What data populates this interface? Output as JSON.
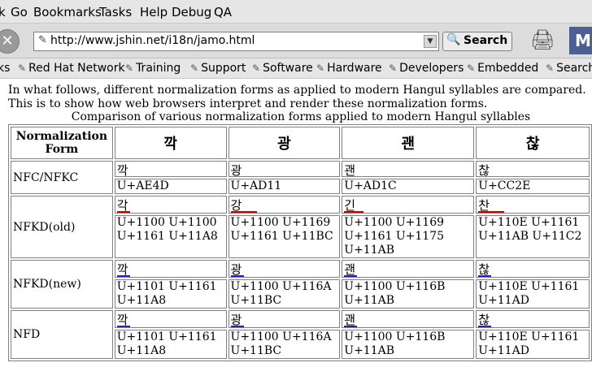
{
  "menubar": {
    "items": [
      "k",
      "Go",
      "Bookmarks",
      "Tasks",
      "Help",
      "Debug",
      "QA"
    ]
  },
  "navbar": {
    "url": "http://www.jshin.net/i18n/jamo.html",
    "search_label": "Search",
    "logo_text": "M"
  },
  "bookmarks": [
    "ks",
    "Red Hat Network",
    "Training",
    "Support",
    "Software",
    "Hardware",
    "Developers",
    "Embedded",
    "Search"
  ],
  "content": {
    "intro": "In what follows, different normalization forms as applied to modern Hangul syllables are compared. This is to show how web browsers interpret and render these normalization forms.",
    "caption": "Comparison of various normalization forms applied to modern Hangul syllables",
    "table": {
      "corner": "Normalization Form",
      "headers": [
        "깍",
        "광",
        "괜",
        "찮"
      ],
      "rows": [
        {
          "label": "NFC/NFKC",
          "cells": [
            {
              "glyph": "깍",
              "codes": "U+AE4D"
            },
            {
              "glyph": "광",
              "codes": "U+AD11"
            },
            {
              "glyph": "괜",
              "codes": "U+AD1C"
            },
            {
              "glyph": "찮",
              "codes": "U+CC2E"
            }
          ]
        },
        {
          "label": "NFKD(old)",
          "cells": [
            {
              "glyph": "각",
              "codes": "U+1100 U+1100 U+1161 U+11A8"
            },
            {
              "glyph": "강",
              "codes": "U+1100 U+1169 U+1161 U+11BC"
            },
            {
              "glyph": "긴",
              "codes": "U+1100 U+1169 U+1161 U+1175 U+11AB"
            },
            {
              "glyph": "찬",
              "codes": "U+110E U+1161 U+11AB U+11C2"
            }
          ]
        },
        {
          "label": "NFKD(new)",
          "cells": [
            {
              "glyph": "깍",
              "codes": "U+1101 U+1161 U+11A8"
            },
            {
              "glyph": "광",
              "codes": "U+1100 U+116A U+11BC"
            },
            {
              "glyph": "괜",
              "codes": "U+1100 U+116B U+11AB"
            },
            {
              "glyph": "찮",
              "codes": "U+110E U+1161 U+11AD"
            }
          ]
        },
        {
          "label": "NFD",
          "cells": [
            {
              "glyph": "깍",
              "codes": "U+1101 U+1161 U+11A8"
            },
            {
              "glyph": "광",
              "codes": "U+1100 U+116A U+11BC"
            },
            {
              "glyph": "괜",
              "codes": "U+1100 U+116B U+11AB"
            },
            {
              "glyph": "찮",
              "codes": "U+110E U+1161 U+11AD"
            }
          ]
        }
      ]
    }
  }
}
